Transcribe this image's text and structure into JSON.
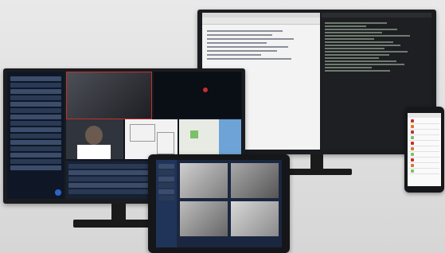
{
  "scene": "multi-screen-monitoring-setup",
  "devices": [
    {
      "id": "monitor-right",
      "content": "document-and-terminal"
    },
    {
      "id": "monitor-left",
      "content": "video-dashboard"
    },
    {
      "id": "tablet",
      "content": "camera-grid"
    },
    {
      "id": "phone",
      "content": "mobile-list"
    }
  ],
  "colors": {
    "accent_blue": "#2f63c8",
    "alert_red": "#c4302b",
    "screen_dark": "#10151f",
    "map_green": "#7cc06a"
  }
}
